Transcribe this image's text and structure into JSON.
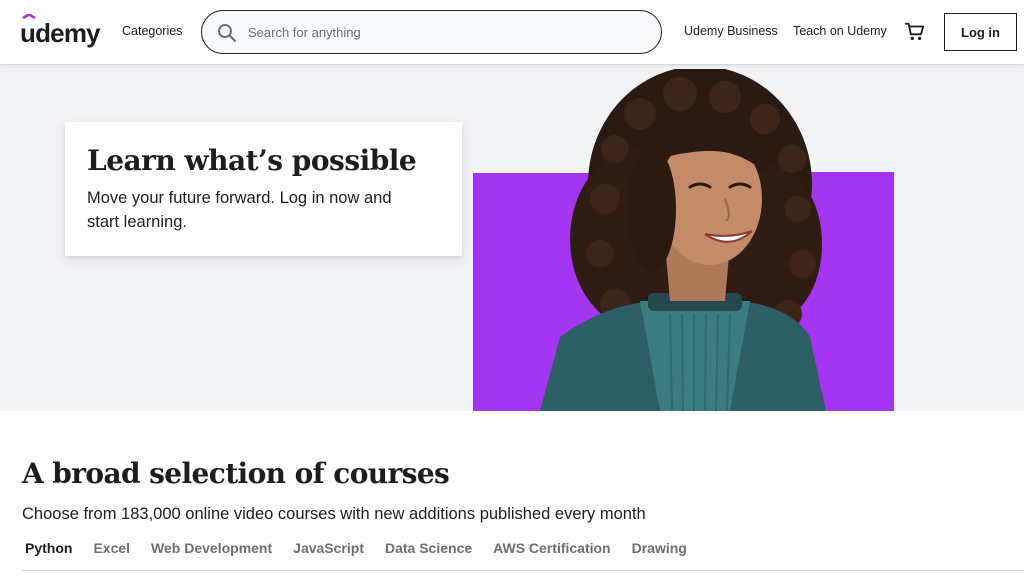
{
  "header": {
    "logo_text": "udemy",
    "categories_label": "Categories",
    "search_placeholder": "Search for anything",
    "business_label": "Udemy Business",
    "teach_label": "Teach on Udemy",
    "login_label": "Log in"
  },
  "hero": {
    "title": "Learn what’s possible",
    "subtitle": "Move your future forward. Log in now and start learning."
  },
  "courses": {
    "title": "A broad selection of courses",
    "subtitle": "Choose from 183,000 online video courses with new additions published every month",
    "tabs": [
      {
        "label": "Python",
        "active": true
      },
      {
        "label": "Excel"
      },
      {
        "label": "Web Development"
      },
      {
        "label": "JavaScript"
      },
      {
        "label": "Data Science"
      },
      {
        "label": "AWS Certification"
      },
      {
        "label": "Drawing"
      }
    ]
  },
  "colors": {
    "brand_purple": "#a435f0",
    "text": "#1c1d1f",
    "hero_bg": "#f2f3f5"
  },
  "icons": [
    "udemy-logo",
    "search-icon",
    "cart-icon"
  ]
}
